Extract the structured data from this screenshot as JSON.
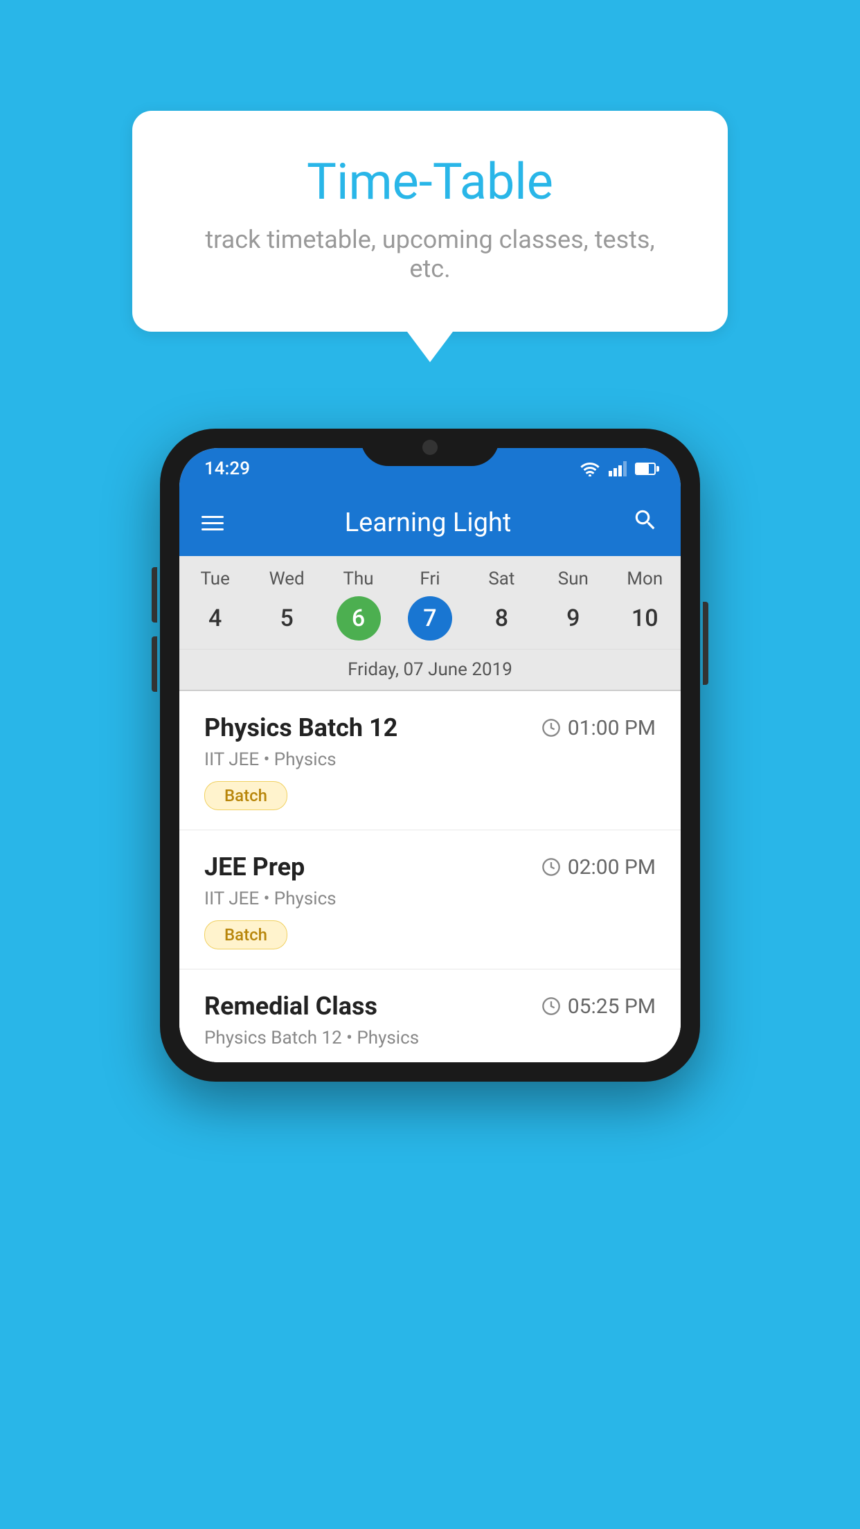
{
  "background_color": "#29B6E8",
  "bubble": {
    "title": "Time-Table",
    "subtitle": "track timetable, upcoming classes, tests, etc."
  },
  "phone": {
    "status_bar": {
      "time": "14:29"
    },
    "app_bar": {
      "title": "Learning Light"
    },
    "calendar": {
      "days": [
        {
          "name": "Tue",
          "num": "4"
        },
        {
          "name": "Wed",
          "num": "5"
        },
        {
          "name": "Thu",
          "num": "6",
          "state": "today"
        },
        {
          "name": "Fri",
          "num": "7",
          "state": "selected"
        },
        {
          "name": "Sat",
          "num": "8"
        },
        {
          "name": "Sun",
          "num": "9"
        },
        {
          "name": "Mon",
          "num": "10"
        }
      ],
      "date_label": "Friday, 07 June 2019"
    },
    "schedule": [
      {
        "name": "Physics Batch 12",
        "time": "01:00 PM",
        "subtitle": "IIT JEE • Physics",
        "badge": "Batch"
      },
      {
        "name": "JEE Prep",
        "time": "02:00 PM",
        "subtitle": "IIT JEE • Physics",
        "badge": "Batch"
      },
      {
        "name": "Remedial Class",
        "time": "05:25 PM",
        "subtitle": "Physics Batch 12 • Physics"
      }
    ]
  }
}
